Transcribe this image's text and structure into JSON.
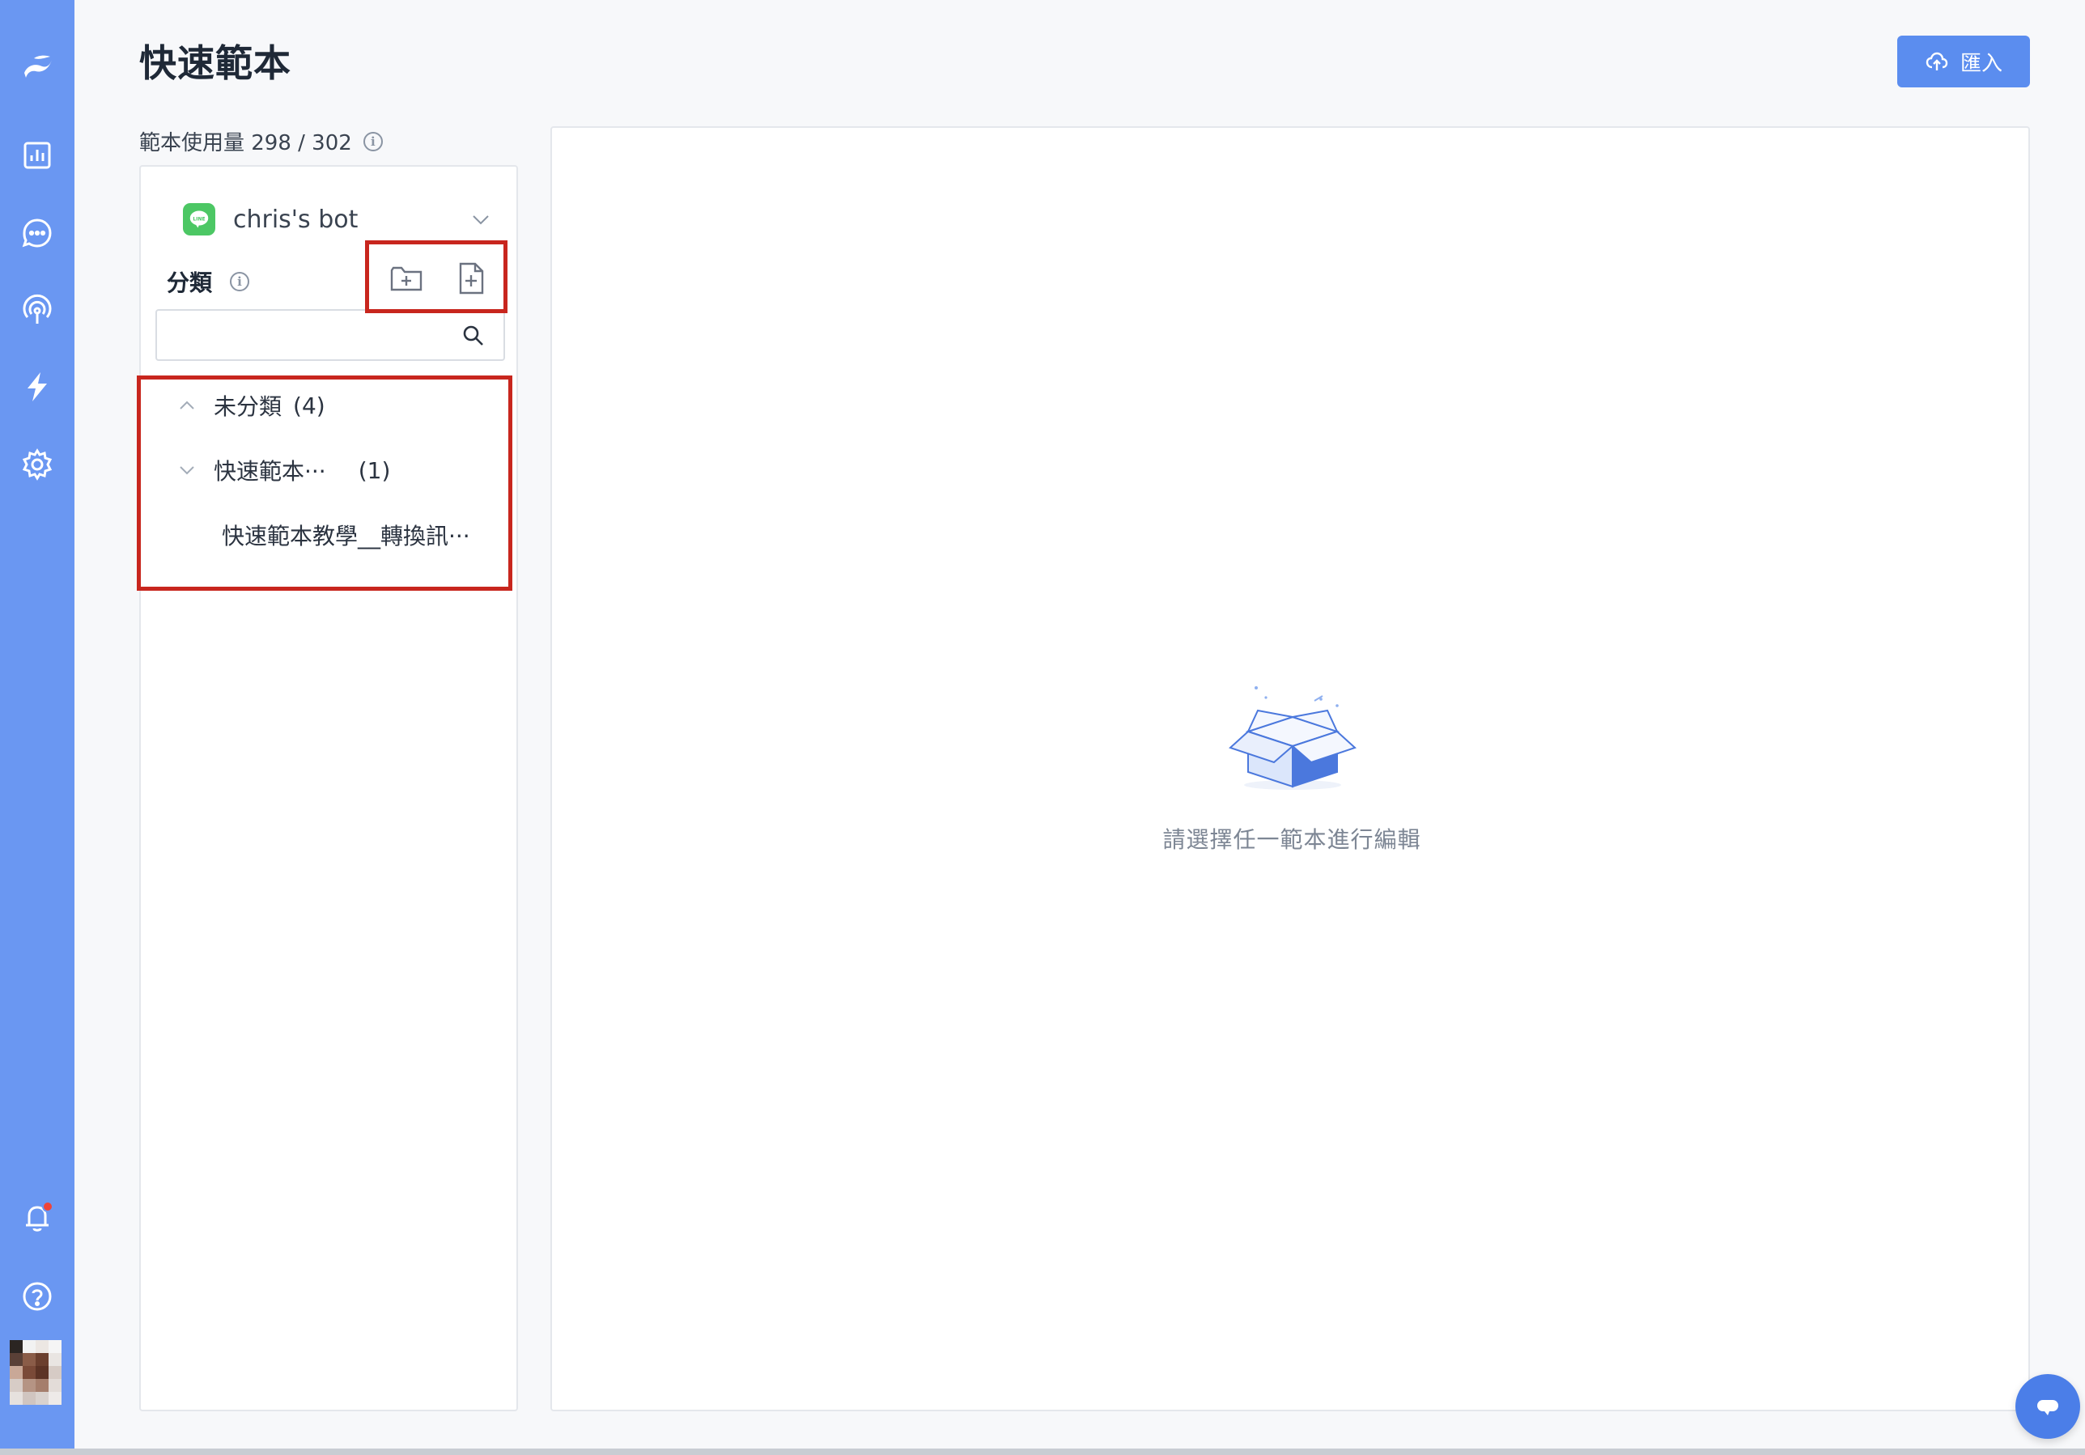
{
  "page": {
    "title": "快速範本",
    "import_label": "匯入",
    "usage_text": "範本使用量 298 / 302"
  },
  "nav": {
    "items": [
      {
        "name": "logo",
        "icon": "brand-logo-icon"
      },
      {
        "name": "analytics",
        "icon": "bar-chart-icon"
      },
      {
        "name": "chat",
        "icon": "chat-bubble-icon"
      },
      {
        "name": "broadcast",
        "icon": "broadcast-icon"
      },
      {
        "name": "automation",
        "icon": "lightning-icon"
      },
      {
        "name": "settings",
        "icon": "gear-icon"
      },
      {
        "name": "notifications",
        "icon": "bell-icon"
      },
      {
        "name": "help",
        "icon": "question-circle-icon"
      },
      {
        "name": "profile",
        "icon": "avatar"
      }
    ],
    "bg_color": "#6a97f2"
  },
  "left_panel": {
    "bot_name": "chris's bot",
    "bot_channel": "LINE",
    "category_label": "分類",
    "search_placeholder": "",
    "tree": [
      {
        "label": "未分類",
        "count": "(4)",
        "expanded": true
      },
      {
        "label": "快速範本···",
        "count": "(1)",
        "expanded": false
      },
      {
        "label": "快速範本教學__轉換訊···",
        "is_leaf": true
      }
    ]
  },
  "main_panel": {
    "empty_text": "請選擇任一範本進行編輯"
  },
  "colors": {
    "accent": "#5b8def",
    "highlight": "#c8261e",
    "line_green": "#4cc764"
  }
}
